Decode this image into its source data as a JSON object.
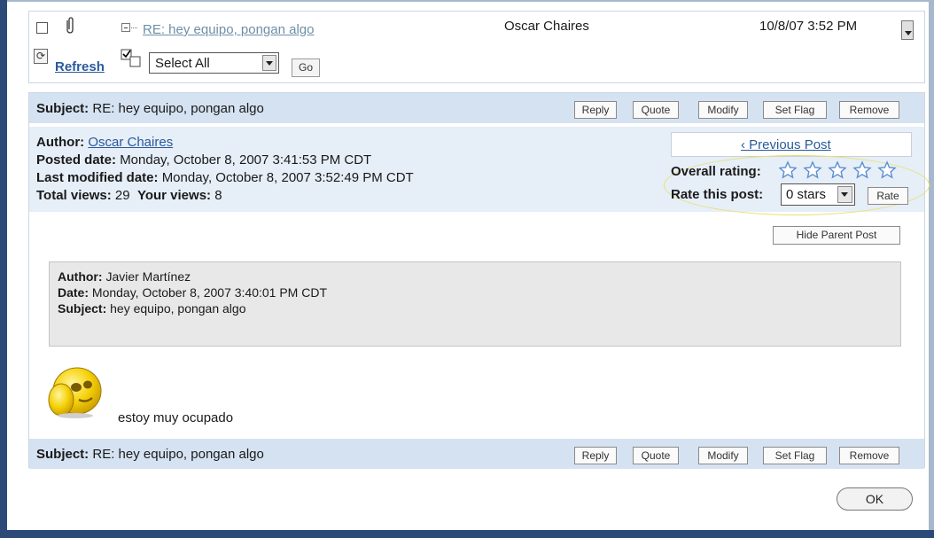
{
  "thread": {
    "subject_link": "RE: hey equipo, pongan algo",
    "author": "Oscar Chaires",
    "date": "10/8/07 3:52 PM"
  },
  "toolbar": {
    "refresh_label": "Refresh",
    "select_value": "Select All",
    "go_label": "Go"
  },
  "post": {
    "subject_label": "Subject:",
    "subject": "RE: hey equipo, pongan algo",
    "actions": {
      "reply": "Reply",
      "quote": "Quote",
      "modify": "Modify",
      "set_flag": "Set Flag",
      "remove": "Remove"
    },
    "author_label": "Author:",
    "author": "Oscar Chaires",
    "posted_label": "Posted date:",
    "posted": "Monday, October 8, 2007 3:41:53 PM CDT",
    "modified_label": "Last modified date:",
    "modified": "Monday, October 8, 2007 3:52:49 PM CDT",
    "total_views_label": "Total views:",
    "total_views": "29",
    "your_views_label": "Your views:",
    "your_views": "8",
    "previous_post": "‹ Previous Post",
    "overall_rating_label": "Overall rating:",
    "overall_rating_stars": 0,
    "rate_label": "Rate this post:",
    "rate_value": "0 stars",
    "rate_button": "Rate",
    "hide_parent": "Hide Parent Post",
    "parent": {
      "author_label": "Author:",
      "author": "Javier Martínez",
      "date_label": "Date:",
      "date": "Monday, October 8, 2007 3:40:01 PM CDT",
      "subject_label": "Subject:",
      "subject": "hey equipo, pongan algo"
    },
    "body": "estoy muy ocupado"
  },
  "dialog": {
    "ok_label": "OK"
  },
  "colors": {
    "header_bar": "#d5e2f1",
    "author_bg": "#e6eef8",
    "link": "#2a5a9a",
    "frame": "#2c4a78",
    "highlight": "#e8e070"
  },
  "icons": [
    "attachment-icon",
    "tree-collapse-icon",
    "refresh-icon",
    "select-all-icon",
    "star-icon",
    "smiley-icon"
  ]
}
